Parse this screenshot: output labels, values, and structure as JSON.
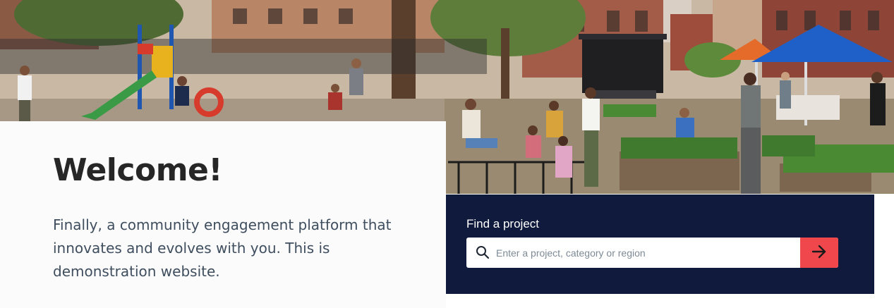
{
  "hero": {
    "image_alt_icon": "community-park-photo"
  },
  "welcome": {
    "title": "Welcome!",
    "body": "Finally, a community engagement platform that innovates and evolves with you. This is demonstration website."
  },
  "search": {
    "label": "Find a project",
    "placeholder": "Enter a project, category or region",
    "value": "",
    "search_icon": "search-icon",
    "submit_icon": "arrow-right-icon"
  },
  "colors": {
    "panel_navy": "#0f1a3c",
    "submit_red": "#f0474d",
    "title_text": "#262626",
    "body_text": "#3f4e5e"
  }
}
